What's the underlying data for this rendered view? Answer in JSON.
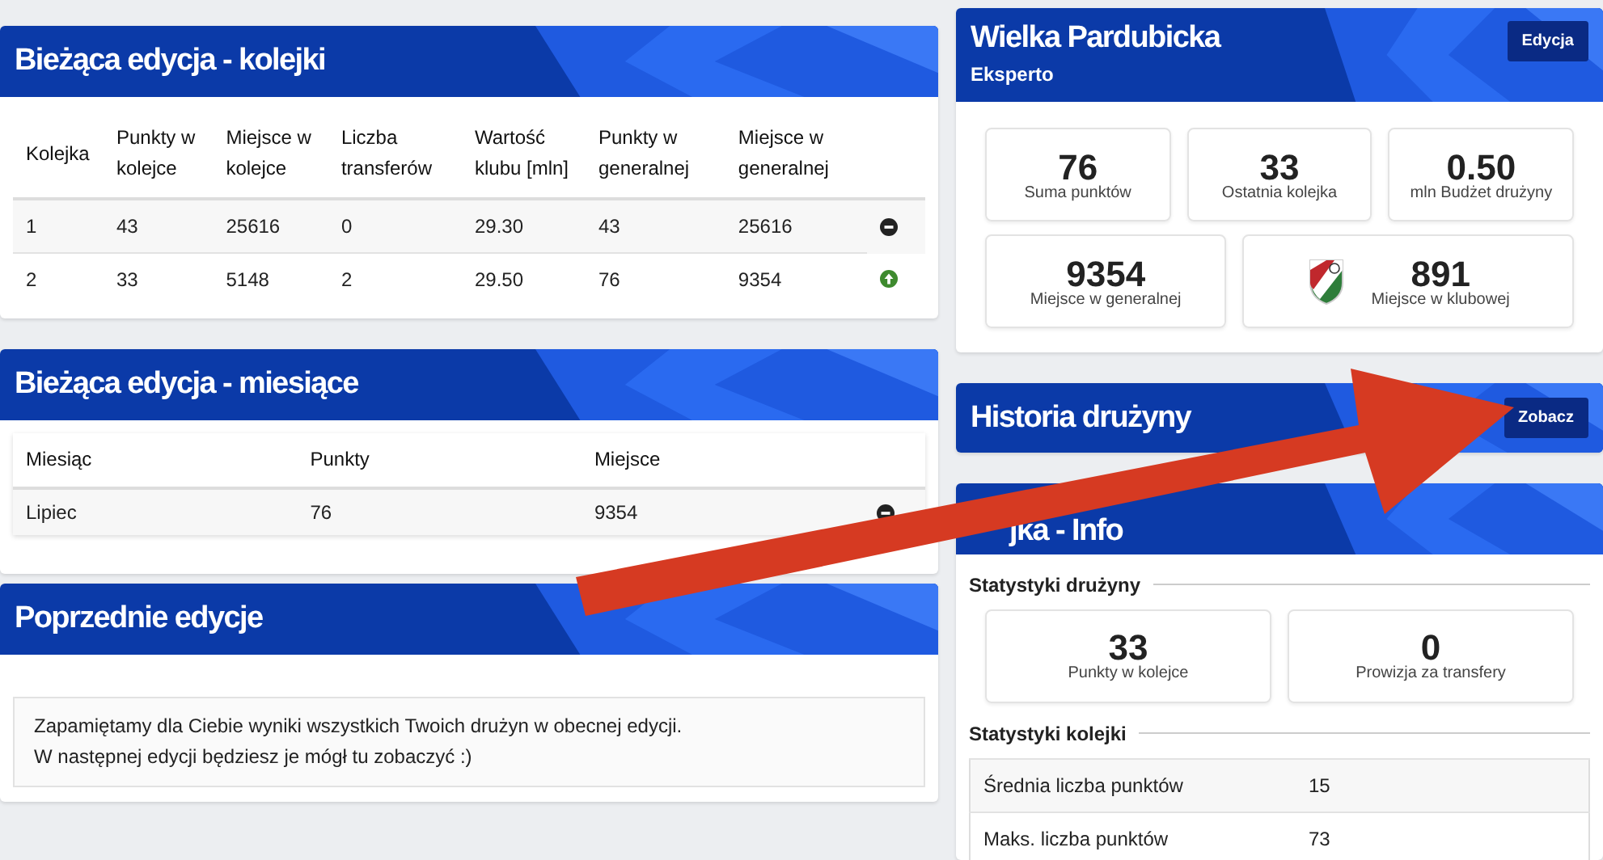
{
  "left": [
    {
      "kind": "table",
      "title": "Bieżąca edycja - kolejki",
      "columns": [
        "Kolejka",
        "Punkty w kolejce",
        "Miejsce w kolejce",
        "Liczba transferów",
        "Wartość klubu [mln]",
        "Punkty w generalnej",
        "Miejsce w generalnej"
      ],
      "rows": [
        {
          "cells": [
            "1",
            "43",
            "25616",
            "0",
            "29.30",
            "43",
            "25616"
          ],
          "kind": "same"
        },
        {
          "cells": [
            "2",
            "33",
            "5148",
            "2",
            "29.50",
            "76",
            "9354"
          ],
          "kind": "up"
        }
      ]
    },
    {
      "kind": "months",
      "title": "Bieżąca edycja - miesiące",
      "columns": [
        "Miesiąc",
        "Punkty",
        "Miejsce"
      ],
      "rows": [
        {
          "cells": [
            "Lipiec",
            "76",
            "9354"
          ],
          "kind": "same"
        }
      ]
    },
    {
      "kind": "message",
      "title": "Poprzednie edycje",
      "lines": [
        "Zapamiętamy dla Ciebie wyniki wszystkich Twoich drużyn w obecnej edycji.",
        "W następnej edycji będziesz je mógł tu zobaczyć :)"
      ]
    }
  ],
  "team": {
    "title": "Wielka Pardubicka",
    "subtitle": "Eksperto",
    "button": "Edycja",
    "stats": [
      {
        "value": "76",
        "label": "Suma punktów"
      },
      {
        "value": "33",
        "label": "Ostatnia kolejka"
      },
      {
        "value": "0.50",
        "label": "mln Budżet drużyny"
      }
    ],
    "stats2": [
      {
        "value": "9354",
        "label": "Miejsce w generalnej",
        "crest": false
      },
      {
        "value": "891",
        "label": "Miejsce w klubowej",
        "crest": true
      }
    ]
  },
  "history": {
    "title": "Historia drużyny",
    "button": "Zobacz"
  },
  "round_info": {
    "title": "jka - Info",
    "team_stats_title": "Statystyki drużyny",
    "team_stats": [
      {
        "value": "33",
        "label": "Punkty w kolejce"
      },
      {
        "value": "0",
        "label": "Prowizja za transfery"
      }
    ],
    "round_stats_title": "Statystyki kolejki",
    "round_stats": [
      {
        "label": "Średnia liczba punktów",
        "value": "15"
      },
      {
        "label": "Maks. liczba punktów",
        "value": "73"
      }
    ]
  },
  "overlay": {
    "kind": "arrow"
  }
}
